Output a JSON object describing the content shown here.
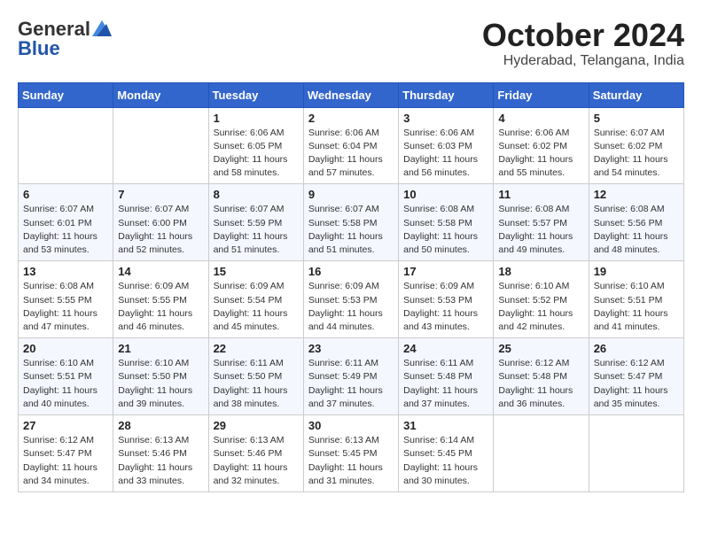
{
  "header": {
    "logo_general": "General",
    "logo_blue": "Blue",
    "month_title": "October 2024",
    "location": "Hyderabad, Telangana, India"
  },
  "weekdays": [
    "Sunday",
    "Monday",
    "Tuesday",
    "Wednesday",
    "Thursday",
    "Friday",
    "Saturday"
  ],
  "weeks": [
    [
      {
        "day": "",
        "info": ""
      },
      {
        "day": "",
        "info": ""
      },
      {
        "day": "1",
        "info": "Sunrise: 6:06 AM\nSunset: 6:05 PM\nDaylight: 11 hours and 58 minutes."
      },
      {
        "day": "2",
        "info": "Sunrise: 6:06 AM\nSunset: 6:04 PM\nDaylight: 11 hours and 57 minutes."
      },
      {
        "day": "3",
        "info": "Sunrise: 6:06 AM\nSunset: 6:03 PM\nDaylight: 11 hours and 56 minutes."
      },
      {
        "day": "4",
        "info": "Sunrise: 6:06 AM\nSunset: 6:02 PM\nDaylight: 11 hours and 55 minutes."
      },
      {
        "day": "5",
        "info": "Sunrise: 6:07 AM\nSunset: 6:02 PM\nDaylight: 11 hours and 54 minutes."
      }
    ],
    [
      {
        "day": "6",
        "info": "Sunrise: 6:07 AM\nSunset: 6:01 PM\nDaylight: 11 hours and 53 minutes."
      },
      {
        "day": "7",
        "info": "Sunrise: 6:07 AM\nSunset: 6:00 PM\nDaylight: 11 hours and 52 minutes."
      },
      {
        "day": "8",
        "info": "Sunrise: 6:07 AM\nSunset: 5:59 PM\nDaylight: 11 hours and 51 minutes."
      },
      {
        "day": "9",
        "info": "Sunrise: 6:07 AM\nSunset: 5:58 PM\nDaylight: 11 hours and 51 minutes."
      },
      {
        "day": "10",
        "info": "Sunrise: 6:08 AM\nSunset: 5:58 PM\nDaylight: 11 hours and 50 minutes."
      },
      {
        "day": "11",
        "info": "Sunrise: 6:08 AM\nSunset: 5:57 PM\nDaylight: 11 hours and 49 minutes."
      },
      {
        "day": "12",
        "info": "Sunrise: 6:08 AM\nSunset: 5:56 PM\nDaylight: 11 hours and 48 minutes."
      }
    ],
    [
      {
        "day": "13",
        "info": "Sunrise: 6:08 AM\nSunset: 5:55 PM\nDaylight: 11 hours and 47 minutes."
      },
      {
        "day": "14",
        "info": "Sunrise: 6:09 AM\nSunset: 5:55 PM\nDaylight: 11 hours and 46 minutes."
      },
      {
        "day": "15",
        "info": "Sunrise: 6:09 AM\nSunset: 5:54 PM\nDaylight: 11 hours and 45 minutes."
      },
      {
        "day": "16",
        "info": "Sunrise: 6:09 AM\nSunset: 5:53 PM\nDaylight: 11 hours and 44 minutes."
      },
      {
        "day": "17",
        "info": "Sunrise: 6:09 AM\nSunset: 5:53 PM\nDaylight: 11 hours and 43 minutes."
      },
      {
        "day": "18",
        "info": "Sunrise: 6:10 AM\nSunset: 5:52 PM\nDaylight: 11 hours and 42 minutes."
      },
      {
        "day": "19",
        "info": "Sunrise: 6:10 AM\nSunset: 5:51 PM\nDaylight: 11 hours and 41 minutes."
      }
    ],
    [
      {
        "day": "20",
        "info": "Sunrise: 6:10 AM\nSunset: 5:51 PM\nDaylight: 11 hours and 40 minutes."
      },
      {
        "day": "21",
        "info": "Sunrise: 6:10 AM\nSunset: 5:50 PM\nDaylight: 11 hours and 39 minutes."
      },
      {
        "day": "22",
        "info": "Sunrise: 6:11 AM\nSunset: 5:50 PM\nDaylight: 11 hours and 38 minutes."
      },
      {
        "day": "23",
        "info": "Sunrise: 6:11 AM\nSunset: 5:49 PM\nDaylight: 11 hours and 37 minutes."
      },
      {
        "day": "24",
        "info": "Sunrise: 6:11 AM\nSunset: 5:48 PM\nDaylight: 11 hours and 37 minutes."
      },
      {
        "day": "25",
        "info": "Sunrise: 6:12 AM\nSunset: 5:48 PM\nDaylight: 11 hours and 36 minutes."
      },
      {
        "day": "26",
        "info": "Sunrise: 6:12 AM\nSunset: 5:47 PM\nDaylight: 11 hours and 35 minutes."
      }
    ],
    [
      {
        "day": "27",
        "info": "Sunrise: 6:12 AM\nSunset: 5:47 PM\nDaylight: 11 hours and 34 minutes."
      },
      {
        "day": "28",
        "info": "Sunrise: 6:13 AM\nSunset: 5:46 PM\nDaylight: 11 hours and 33 minutes."
      },
      {
        "day": "29",
        "info": "Sunrise: 6:13 AM\nSunset: 5:46 PM\nDaylight: 11 hours and 32 minutes."
      },
      {
        "day": "30",
        "info": "Sunrise: 6:13 AM\nSunset: 5:45 PM\nDaylight: 11 hours and 31 minutes."
      },
      {
        "day": "31",
        "info": "Sunrise: 6:14 AM\nSunset: 5:45 PM\nDaylight: 11 hours and 30 minutes."
      },
      {
        "day": "",
        "info": ""
      },
      {
        "day": "",
        "info": ""
      }
    ]
  ]
}
